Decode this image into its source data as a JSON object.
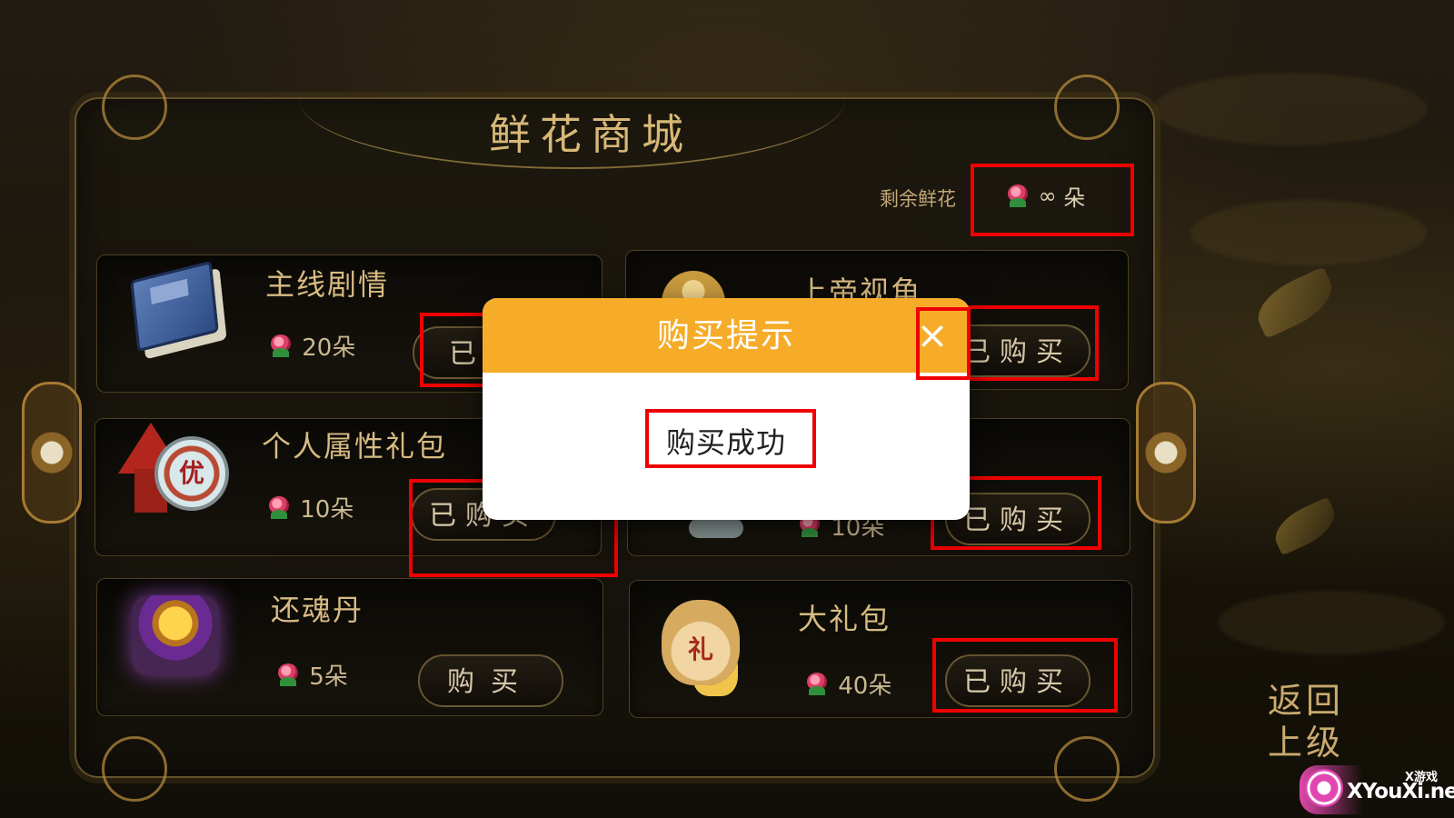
{
  "shop": {
    "title": "鲜花商城",
    "remaining_label": "剩余鲜花",
    "remaining_value": "∞",
    "remaining_unit": "朵",
    "icon": "rose-icon"
  },
  "items": [
    {
      "name": "主线剧情",
      "price": "20朵",
      "button": "已购买",
      "visible_button_text": "已购",
      "icon": "blue-book-icon"
    },
    {
      "name": "上帝视角",
      "price": "",
      "button": "已购买",
      "icon": "golden-god-icon"
    },
    {
      "name": "个人属性礼包",
      "price": "10朵",
      "button": "已购买",
      "icon": "potion-bottle-icon"
    },
    {
      "name": "",
      "price": "10朵",
      "button": "已购买",
      "icon": "partial-item-icon"
    },
    {
      "name": "还魂丹",
      "price": "5朵",
      "button": "购买",
      "icon": "treasure-chest-icon"
    },
    {
      "name": "大礼包",
      "price": "40朵",
      "button": "已购买",
      "icon": "gift-bag-icon"
    }
  ],
  "dialog": {
    "title": "购买提示",
    "message": "购买成功",
    "close_icon": "close-icon"
  },
  "navigation": {
    "back_line_1": "返回",
    "back_line_2": "上级"
  },
  "watermark": {
    "small_text": "X游戏",
    "site_text": "XYouXi.net"
  },
  "colors": {
    "dialog_header": "#f6ac29",
    "highlight_box": "#f00000",
    "gold_text": "#d8bb83"
  }
}
